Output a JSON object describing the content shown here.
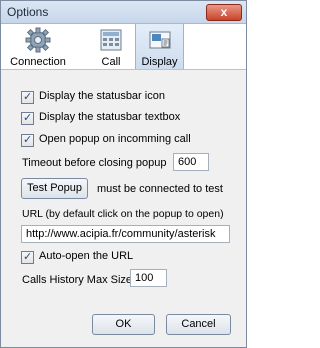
{
  "window": {
    "title": "Options",
    "close_symbol": "x"
  },
  "tabs": [
    {
      "label": "Connection",
      "icon": "gear-icon",
      "selected": false
    },
    {
      "label": "Call",
      "icon": "calculator-icon",
      "selected": false
    },
    {
      "label": "Display",
      "icon": "display-icon",
      "selected": true
    }
  ],
  "options": {
    "statusbar_icon": {
      "label": "Display the statusbar icon",
      "checked": true
    },
    "statusbar_textbox": {
      "label": "Display the statusbar textbox",
      "checked": true
    },
    "open_popup": {
      "label": "Open popup on incomming call",
      "checked": true
    },
    "timeout": {
      "label": "Timeout before closing popup",
      "value": "600"
    },
    "test_popup": {
      "button_label": "Test Popup",
      "note": "must be connected to test"
    },
    "url": {
      "label": "URL (by default click on the popup to open)",
      "value": "http://www.acipia.fr/community/asterisk"
    },
    "auto_open": {
      "label": "Auto-open the URL",
      "checked": true
    },
    "history": {
      "label": "Calls History Max Size",
      "value": "100"
    }
  },
  "buttons": {
    "ok": "OK",
    "cancel": "Cancel"
  },
  "colors": {
    "accent": "#1e4c8f",
    "selected_tab": "#cddcee"
  }
}
